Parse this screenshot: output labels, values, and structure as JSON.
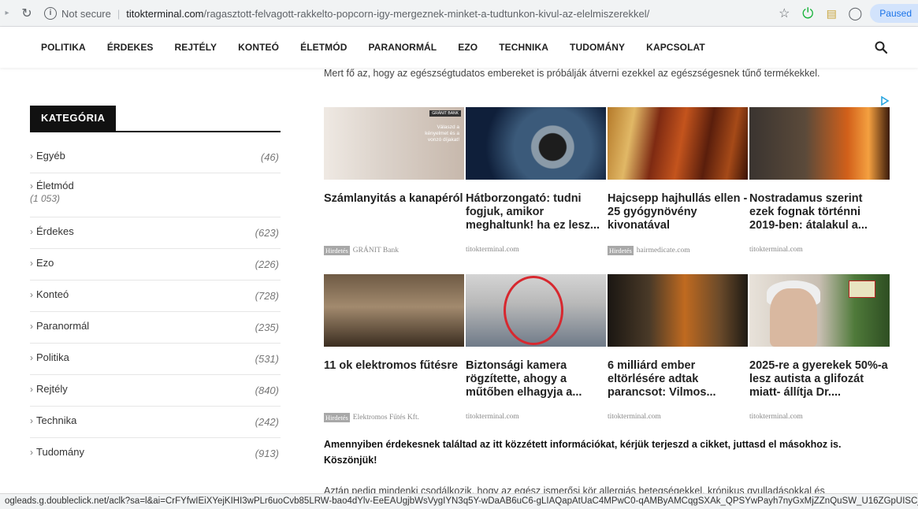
{
  "browser": {
    "security_label": "Not secure",
    "url_host": "titokterminal.com",
    "url_path": "/ragasztott-felvagott-rakkelto-popcorn-igy-mergeznek-minket-a-tudtunkon-kivul-az-elelmiszerekkel/",
    "paused_label": "Paused",
    "status_url": "ogleads.g.doubleclick.net/aclk?sa=l&ai=CrFYfwIEiXYejKIHI3wPLr6uoCvb85LRW-bao4dYlv-EeEAUgjbWsVygIYN3q5Y-wDaAB6uC6-gLIAQapAtUaC4MPwC0-qAMByAMCqgSXAk_QPSYwPayh7nyGxMjZZnQuSW_U16ZGpUISCjSq9_r-mqfVLtF"
  },
  "nav": {
    "items": [
      "POLITIKA",
      "ÉRDEKES",
      "REJTÉLY",
      "KONTEÓ",
      "ÉLETMÓD",
      "PARANORMÁL",
      "EZO",
      "TECHNIKA",
      "TUDOMÁNY",
      "KAPCSOLAT"
    ]
  },
  "sidebar": {
    "heading": "KATEGÓRIA",
    "categories": [
      {
        "label": "Egyéb",
        "count": "(46)"
      },
      {
        "label": "Életmód",
        "count": "(1 053)"
      },
      {
        "label": "Érdekes",
        "count": "(623)"
      },
      {
        "label": "Ezo",
        "count": "(226)"
      },
      {
        "label": "Konteó",
        "count": "(728)"
      },
      {
        "label": "Paranormál",
        "count": "(235)"
      },
      {
        "label": "Politika",
        "count": "(531)"
      },
      {
        "label": "Rejtély",
        "count": "(840)"
      },
      {
        "label": "Technika",
        "count": "(242)"
      },
      {
        "label": "Tudomány",
        "count": "(913)"
      }
    ]
  },
  "content": {
    "intro": "Mert fő az, hogy az egészségtudatos embereket is próbálják átverni ezekkel az egészségesnek tűnő termékekkel.",
    "ads": [
      {
        "title": "Számlanyitás a kanapéról",
        "badge": "Hirdetés",
        "source": "GRÁNIT Bank",
        "bank_tag": "GRÁNIT BANK",
        "bank_text": "Válaszd a kényelmet és a vonzó díjakat!"
      },
      {
        "title": "Hátborzongató: tudni fogjuk, amikor meghaltunk! ha ez lesz...",
        "badge": "",
        "source": "titokterminal.com"
      },
      {
        "title": "Hajcsepp hajhullás ellen - 25 gyógynövény kivonatával",
        "badge": "Hirdetés",
        "source": "hairmedicate.com"
      },
      {
        "title": "Nostradamus szerint ezek fognak történni 2019-ben: átalakul a...",
        "badge": "",
        "source": "titokterminal.com"
      },
      {
        "title": "11 ok elektromos fűtésre",
        "badge": "Hirdetés",
        "source": "Elektromos Fűtés Kft."
      },
      {
        "title": "Biztonsági kamera rögzítette, ahogy a műtőben elhagyja a...",
        "badge": "",
        "source": "titokterminal.com"
      },
      {
        "title": "6 milliárd ember eltörlésére adtak parancsot: Vilmos...",
        "badge": "",
        "source": "titokterminal.com"
      },
      {
        "title": "2025-re a gyerekek 50%-a lesz autista a glifozát miatt- állítja Dr....",
        "badge": "",
        "source": "titokterminal.com"
      }
    ],
    "share_line1": "Amennyiben érdekesnek találtad az itt közzétett információkat, kérjük terjeszd a cikket, juttasd el másokhoz is.",
    "share_line2": "Köszönjük!",
    "more": "Aztán pedig mindenki csodálkozik, hogy az egész ismerősi kör allergiás betegségekkel, krónikus gyulladásokkal és"
  }
}
